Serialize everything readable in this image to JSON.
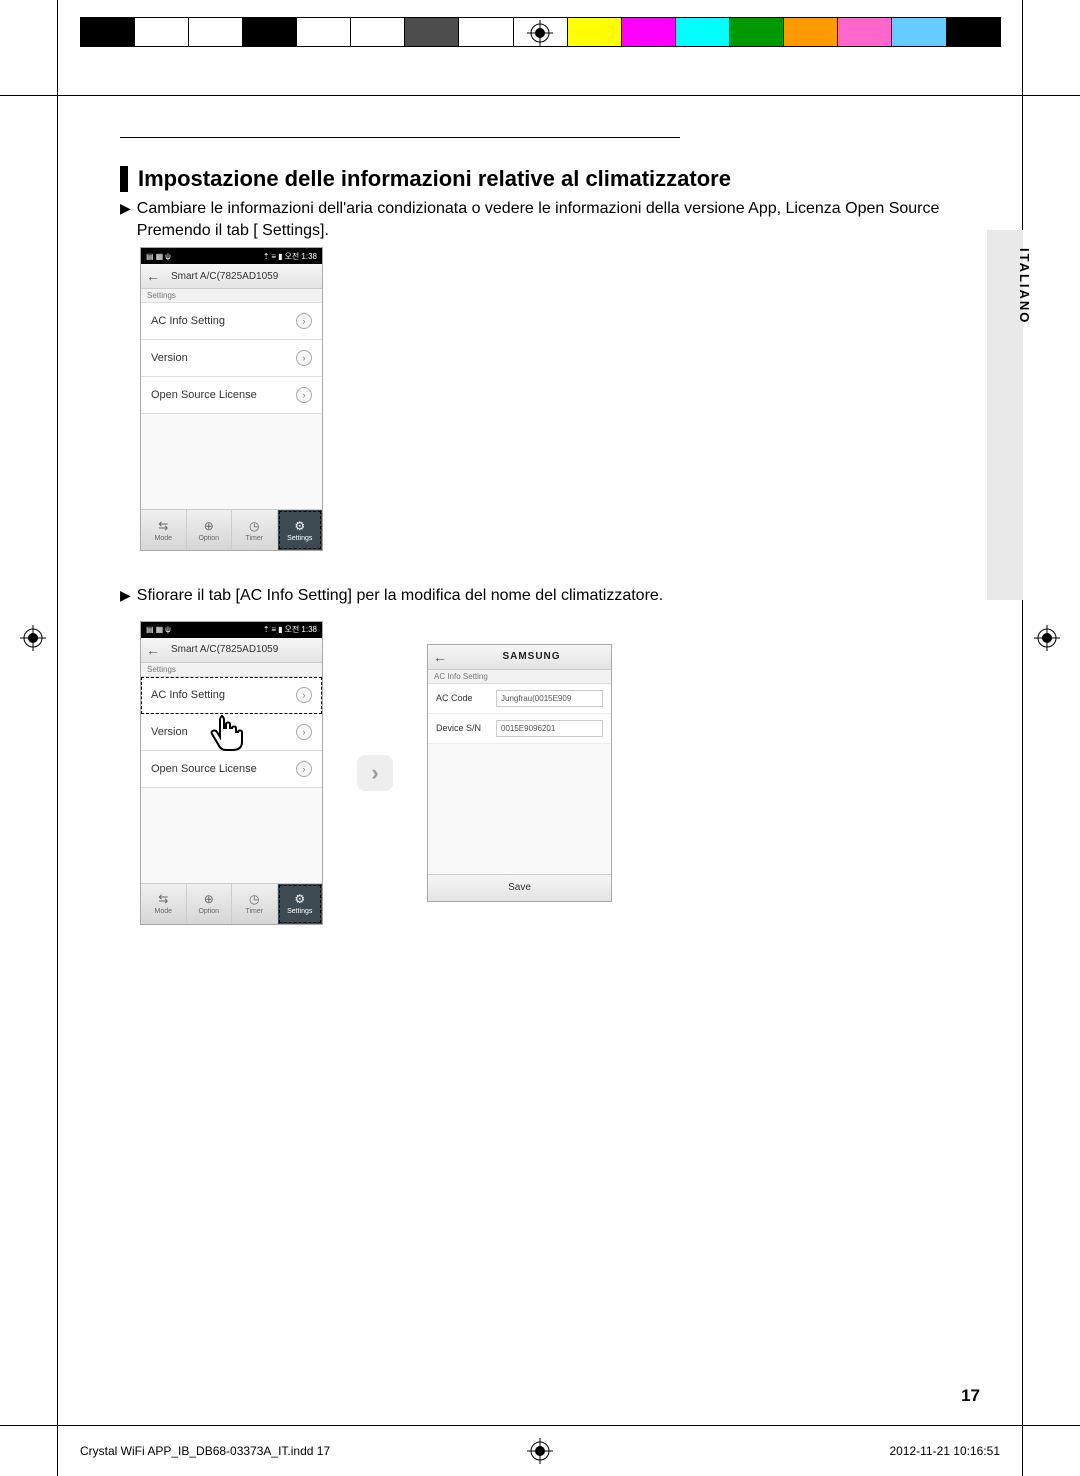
{
  "color_bar": [
    "#000000",
    "#ffffff",
    "#ffffff",
    "#000000",
    "#ffffff",
    "#ffffff",
    "#4d4d4d",
    "#ffffff",
    "#ffffff",
    "#ffff00",
    "#ff00ff",
    "#00ffff",
    "#009900",
    "#ff9900",
    "#ff66cc",
    "#66ccff",
    "#000000"
  ],
  "heading": "Impostazione delle informazioni relative al climatizzatore",
  "bullets": [
    "Cambiare le informazioni dell'aria condizionata o vedere le informazioni della versione App, Licenza Open Source Premendo il tab [ Settings].",
    "Sfiorare il tab [AC Info Setting] per la modifica del nome del climatizzatore."
  ],
  "phone": {
    "status_left_icons": [
      "doc-icon",
      "gallery-icon",
      "usb-icon"
    ],
    "status_right_icons": [
      "wifi-icon",
      "bt-icon",
      "signal-icon",
      "battery-icon"
    ],
    "status_time": "오전 1:38",
    "back": "←",
    "title": "Smart A/C(7825AD1059",
    "crumb": "Settings",
    "items": [
      "AC Info Setting",
      "Version",
      "Open Source License"
    ],
    "tabs": [
      {
        "icon": "⇆",
        "label": "Mode"
      },
      {
        "icon": "⊕",
        "label": "Option"
      },
      {
        "icon": "◷",
        "label": "Timer"
      },
      {
        "icon": "⚙",
        "label": "Settings"
      }
    ]
  },
  "detail": {
    "back": "←",
    "brand": "SAMSUNG",
    "crumb": "AC Info Setting",
    "fields": [
      {
        "label": "AC Code",
        "value": "Jungfrau(0015E909"
      },
      {
        "label": "Device S/N",
        "value": "0015E9096201"
      }
    ],
    "save": "Save"
  },
  "lang_tab": "ITALIANO",
  "page_num": "17",
  "footer_left": "Crystal WiFi APP_IB_DB68-03373A_IT.indd   17",
  "footer_right": "2012-11-21   10:16:51"
}
